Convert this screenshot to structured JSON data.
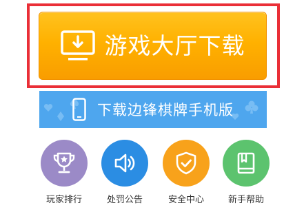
{
  "download_panel": {
    "hall_button_label": "游戏大厅下载",
    "mobile_button_label": "下载边锋棋牌手机版"
  },
  "quick_links": [
    {
      "label": "玩家排行",
      "icon": "trophy-icon",
      "color": "#9b8ac7"
    },
    {
      "label": "处罚公告",
      "icon": "speaker-icon",
      "color": "#2b8de3"
    },
    {
      "label": "安全中心",
      "icon": "shield-icon",
      "color": "#f8a21b"
    },
    {
      "label": "新手帮助",
      "icon": "book-icon",
      "color": "#5cc36e"
    }
  ],
  "colors": {
    "highlight": "#ea2f37",
    "hall_button": "#ffb100",
    "mobile_button": "#4ea6ee"
  }
}
